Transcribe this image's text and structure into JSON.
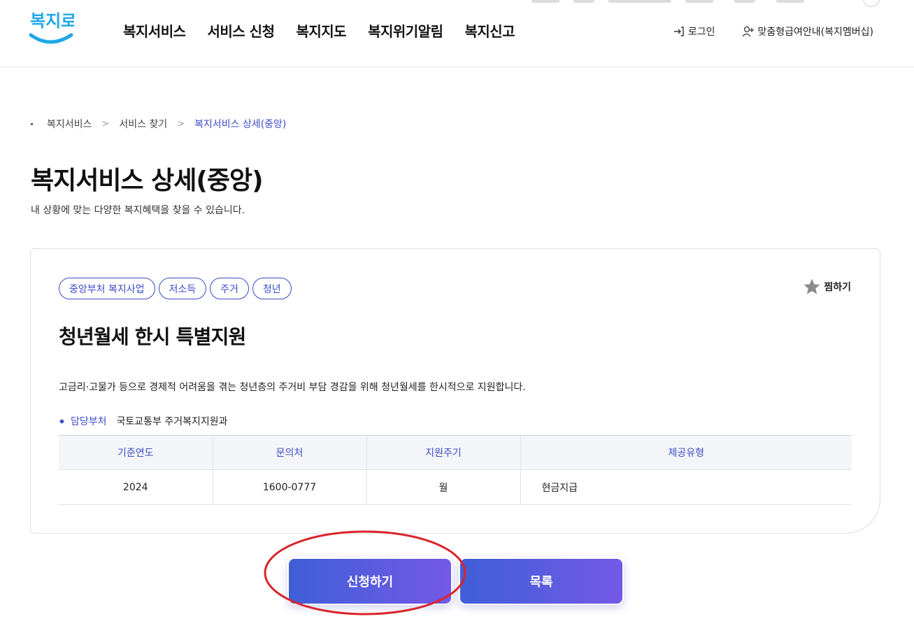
{
  "header": {
    "logo_text": "복지로",
    "nav": [
      "복지서비스",
      "서비스 신청",
      "복지지도",
      "복지위기알림",
      "복지신고"
    ],
    "login_label": "로그인",
    "membership_label": "맞춤형급여안내(복지멤버십)",
    "login_icon": "login-icon",
    "membership_icon": "user-add-icon"
  },
  "breadcrumb": {
    "items": [
      "복지서비스",
      "서비스 찾기",
      "복지서비스 상세(중앙)"
    ]
  },
  "page": {
    "title": "복지서비스 상세(중앙)",
    "description": "내 상황에 맞는 다양한 복지혜택을 찾을 수 있습니다."
  },
  "service": {
    "tags": [
      "중앙부처 복지사업",
      "저소득",
      "주거",
      "청년"
    ],
    "favorite_label": "찜하기",
    "title": "청년월세 한시 특별지원",
    "description": "고금리·고물가 등으로 경제적 어려움을 겪는 청년층의 주거비 부담 경감을 위해 청년월세를 한시적으로 지원합니다.",
    "department_label": "담당부처",
    "department_value": "국토교통부 주거복지지원과",
    "table": {
      "headers": [
        "기준연도",
        "문의처",
        "지원주기",
        "제공유형"
      ],
      "row": [
        "2024",
        "1600-0777",
        "월",
        "현금지급"
      ]
    }
  },
  "actions": {
    "apply_label": "신청하기",
    "list_label": "목록"
  },
  "colors": {
    "accent": "#3a4bc9",
    "button_gradient_start": "#3f5fd7",
    "button_gradient_end": "#7459e6",
    "logo_blue": "#1fa8e6",
    "highlight_circle": "#d9252a"
  }
}
